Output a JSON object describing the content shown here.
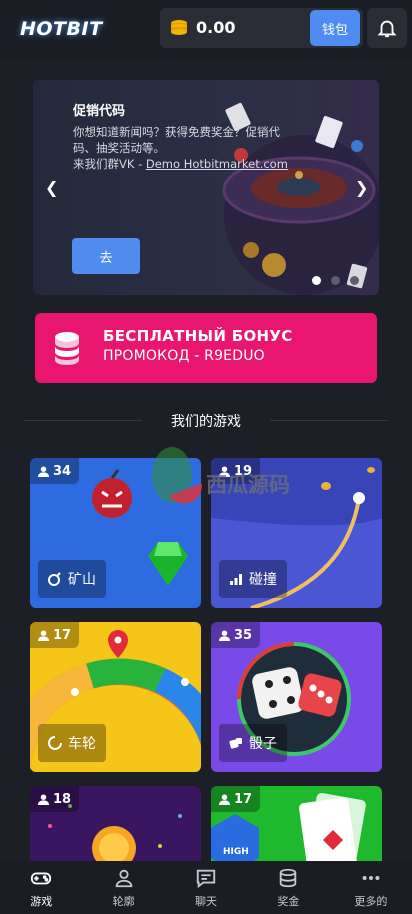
{
  "header": {
    "logo_text": "HOTBIT",
    "balance": "0.00",
    "wallet_label": "钱包",
    "icons": [
      "coin-icon",
      "bell-icon"
    ]
  },
  "banner": {
    "title": "促销代码",
    "line1": "你想知道新闻吗？获得免费奖金？促销代码、抽奖活动等。",
    "line2_prefix": "来我们群VK - ",
    "line2_link": "Demo Hotbitmarket.com",
    "button_label": "去",
    "slides": 3,
    "active_slide": 1
  },
  "bonus": {
    "title": "БЕСПЛАТНЫЙ БОНУС",
    "code": "ПРОМОКОД - R9EDUO"
  },
  "games_section": {
    "title": "我们的游戏",
    "games": [
      {
        "name": "矿山",
        "players": "34",
        "color": "#2f6be0"
      },
      {
        "name": "碰撞",
        "players": "19",
        "color": "#4a57d4"
      },
      {
        "name": "车轮",
        "players": "17",
        "color": "#f5c518"
      },
      {
        "name": "骰子",
        "players": "35",
        "color": "#7a4ae8"
      },
      {
        "name": "",
        "players": "18",
        "color": "#3a1560"
      },
      {
        "name": "",
        "players": "17",
        "color": "#1fb92e"
      }
    ],
    "high_badge": "HIGH"
  },
  "watermark": "西瓜源码",
  "nav": {
    "items": [
      {
        "label": "游戏",
        "icon": "gamepad-icon",
        "active": true
      },
      {
        "label": "轮廓",
        "icon": "user-icon",
        "active": false
      },
      {
        "label": "聊天",
        "icon": "chat-icon",
        "active": false
      },
      {
        "label": "奖金",
        "icon": "coins-icon",
        "active": false
      },
      {
        "label": "更多的",
        "icon": "more-icon",
        "active": false
      }
    ]
  }
}
